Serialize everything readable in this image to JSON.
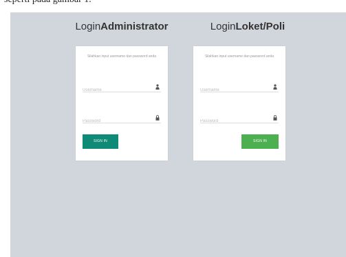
{
  "caption": "seperti pada gambar 1.",
  "admin": {
    "title_prefix": "Login",
    "title_bold": "Administrator",
    "hint": "Silahkan input username dan password anda",
    "username_placeholder": "Username",
    "password_placeholder": "Password",
    "button_label": "SIGN IN"
  },
  "loket": {
    "title_prefix": "Login",
    "title_bold": "Loket/Poli",
    "hint": "Silahkan input username dan password anda",
    "username_placeholder": "Username",
    "password_placeholder": "Password",
    "button_label": "SIGN IN"
  },
  "colors": {
    "background": "#d1d5dc",
    "admin_button": "#0e8a76",
    "loket_button": "#4caf50"
  },
  "icons": {
    "username": "user-icon",
    "password": "lock-icon"
  }
}
